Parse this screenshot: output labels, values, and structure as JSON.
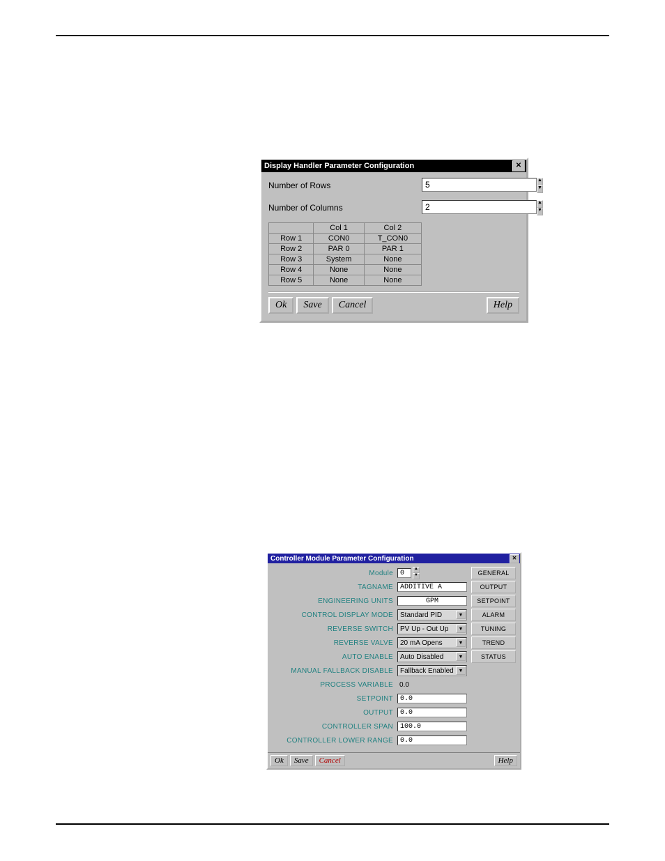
{
  "dialog1": {
    "title": "Display Handler Parameter Configuration",
    "rows_label": "Number of Rows",
    "rows_value": "5",
    "cols_label": "Number of Columns",
    "cols_value": "2",
    "table": {
      "headers": [
        "",
        "Col 1",
        "Col 2"
      ],
      "rows": [
        [
          "Row 1",
          "CON0",
          "T_CON0"
        ],
        [
          "Row 2",
          "PAR 0",
          "PAR 1"
        ],
        [
          "Row 3",
          "System",
          "None"
        ],
        [
          "Row 4",
          "None",
          "None"
        ],
        [
          "Row 5",
          "None",
          "None"
        ]
      ]
    },
    "buttons": {
      "ok": "Ok",
      "save": "Save",
      "cancel": "Cancel",
      "help": "Help"
    }
  },
  "dialog2": {
    "title": "Controller Module Parameter Configuration",
    "fields": {
      "module_label": "Module",
      "module_value": "0",
      "tagname_label": "TAGNAME",
      "tagname_value": "ADDITIVE A",
      "units_label": "ENGINEERING UNITS",
      "units_value": "GPM",
      "control_mode_label": "CONTROL DISPLAY MODE",
      "control_mode_value": "Standard PID",
      "reverse_switch_label": "REVERSE SWITCH",
      "reverse_switch_value": "PV Up - Out Up",
      "reverse_valve_label": "REVERSE VALVE",
      "reverse_valve_value": "20 mA Opens",
      "auto_enable_label": "AUTO ENABLE",
      "auto_enable_value": "Auto Disabled",
      "fallback_label": "MANUAL FALLBACK DISABLE",
      "fallback_value": "Fallback Enabled",
      "pv_label": "PROCESS VARIABLE",
      "pv_value": "0.0",
      "setpoint_label": "SETPOINT",
      "setpoint_value": "0.0",
      "output_label": "OUTPUT",
      "output_value": "0.0",
      "span_label": "CONTROLLER SPAN",
      "span_value": "100.0",
      "lower_label": "CONTROLLER LOWER RANGE",
      "lower_value": "0.0"
    },
    "tabs": {
      "general": "GENERAL",
      "output": "OUTPUT",
      "setpoint": "SETPOINT",
      "alarm": "ALARM",
      "tuning": "TUNING",
      "trend": "TREND",
      "status": "STATUS"
    },
    "buttons": {
      "ok": "Ok",
      "save": "Save",
      "cancel": "Cancel",
      "help": "Help"
    }
  }
}
